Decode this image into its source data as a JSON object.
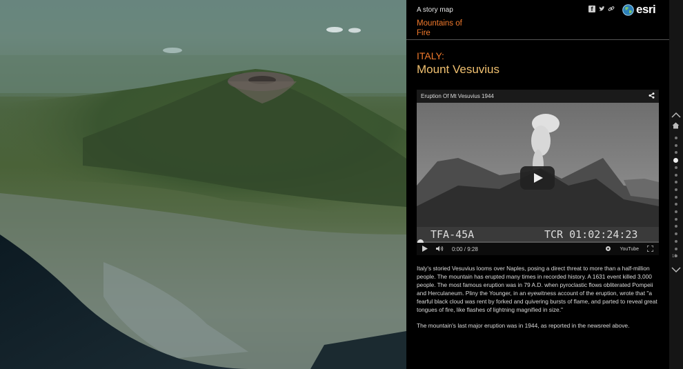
{
  "header": {
    "kicker": "A story map",
    "series_title": "Mountains of Fire",
    "social_icons": [
      "facebook-icon",
      "twitter-icon",
      "link-icon"
    ],
    "brand": "esri"
  },
  "section": {
    "country": "ITALY:",
    "title": "Mount Vesuvius"
  },
  "video": {
    "title": "Eruption Of Mt Vesuvius 1944",
    "overlay_left": "TFA-45A",
    "overlay_right": "TCR 01:02:24:23",
    "time": "0:00 / 9:28",
    "brand": "YouTube"
  },
  "body": {
    "paragraph1": "Italy's storied Vesuvius looms over Naples, posing a direct threat to more than a half-million people. The mountain has erupted many times in recorded history. A 1631 event killed 3,000 people. The most famous eruption was in 79 A.D. when pyroclastic flows obliterated Pompeii and Herculaneum. Pliny the Younger, in an eyewitness account of the eruption, wrote that \"a fearful black cloud was rent by forked and quivering bursts of flame, and parted to reveal great tongues of fire, like flashes of lightning magnified in size.\"",
    "paragraph2": "The mountain's last major eruption was in 1944, as reported in the newsreel above."
  },
  "rail": {
    "page_number": "16",
    "active_index": 3,
    "dot_count": 17
  },
  "colors": {
    "accent": "#f27a2c",
    "title": "#f0c070",
    "panel_bg": "#000000"
  }
}
